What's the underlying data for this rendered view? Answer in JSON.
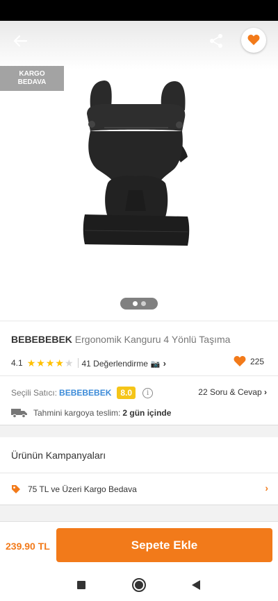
{
  "colors": {
    "accent": "#f27a1a",
    "star": "#ffc000",
    "seller_link": "#3c8bd8",
    "seller_score_bg": "#f5c518"
  },
  "header": {
    "back_icon": "arrow-left-icon",
    "share_icon": "share-icon",
    "favorite_icon": "heart-icon"
  },
  "badge": {
    "line1": "KARGO",
    "line2": "BEDAVA"
  },
  "carousel": {
    "image_count": 2,
    "active_index": 0
  },
  "product": {
    "brand": "BEBEBEBEK",
    "name": "Ergonomik Kanguru 4 Yönlü Taşıma",
    "rating": "4.1",
    "rating_value": 4.1,
    "stars_total": 5,
    "reviews_label": "41 Değerlendirme",
    "likes": "225"
  },
  "seller": {
    "label": "Seçili Satıcı:",
    "name": "BEBEBEBEK",
    "score": "8.0",
    "qa_label": "22 Soru & Cevap"
  },
  "delivery": {
    "label": "Tahmini kargoya teslim:",
    "value": "2 gün içinde"
  },
  "campaigns": {
    "title": "Ürünün Kampanyaları",
    "items": [
      {
        "label": "75 TL ve Üzeri Kargo Bedava"
      }
    ]
  },
  "cart": {
    "price": "239.90 TL",
    "button_label": "Sepete Ekle"
  },
  "nav": {
    "recents_icon": "square-icon",
    "home_icon": "circle-icon",
    "back_icon": "triangle-back-icon"
  }
}
